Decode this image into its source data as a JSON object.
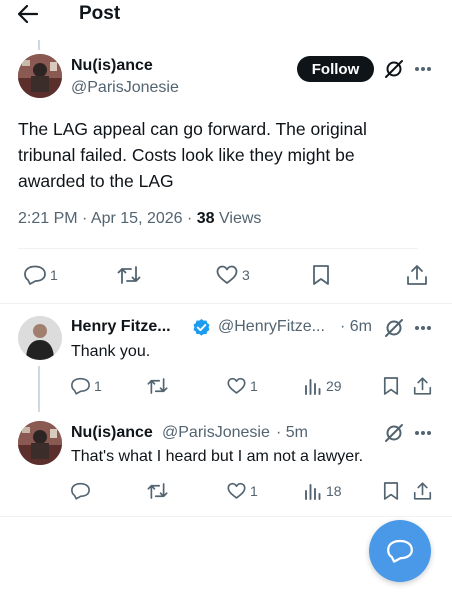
{
  "header": {
    "title": "Post",
    "back_icon": "arrow-left-icon"
  },
  "main_post": {
    "author_name": "Nu(is)ance",
    "author_handle": "@ParisJonesie",
    "follow_label": "Follow",
    "text": "The LAG appeal can go forward. The original tribunal failed. Costs look like they might be awarded to the LAG",
    "time": "2:21 PM · Apr 15, 2026 · ",
    "views_count": "38",
    "views_label": " Views",
    "reply_count": "1",
    "like_count": "3"
  },
  "replies": [
    {
      "author_name": "Henry Fitze...",
      "verified": true,
      "author_handle": "@HenryFitze...",
      "time": "· 6m",
      "text": "Thank you.",
      "reply_count": "1",
      "like_count": "1",
      "view_count": "29"
    },
    {
      "author_name": "Nu(is)ance",
      "author_handle": "@ParisJonesie",
      "time": "· 5m",
      "text": "That's what I heard but I am not a lawyer.",
      "like_count": "1",
      "view_count": "18"
    }
  ],
  "colors": {
    "accent": "#1d9bf0",
    "fab": "#4a99e9",
    "text": "#0f1419",
    "muted": "#536471"
  }
}
